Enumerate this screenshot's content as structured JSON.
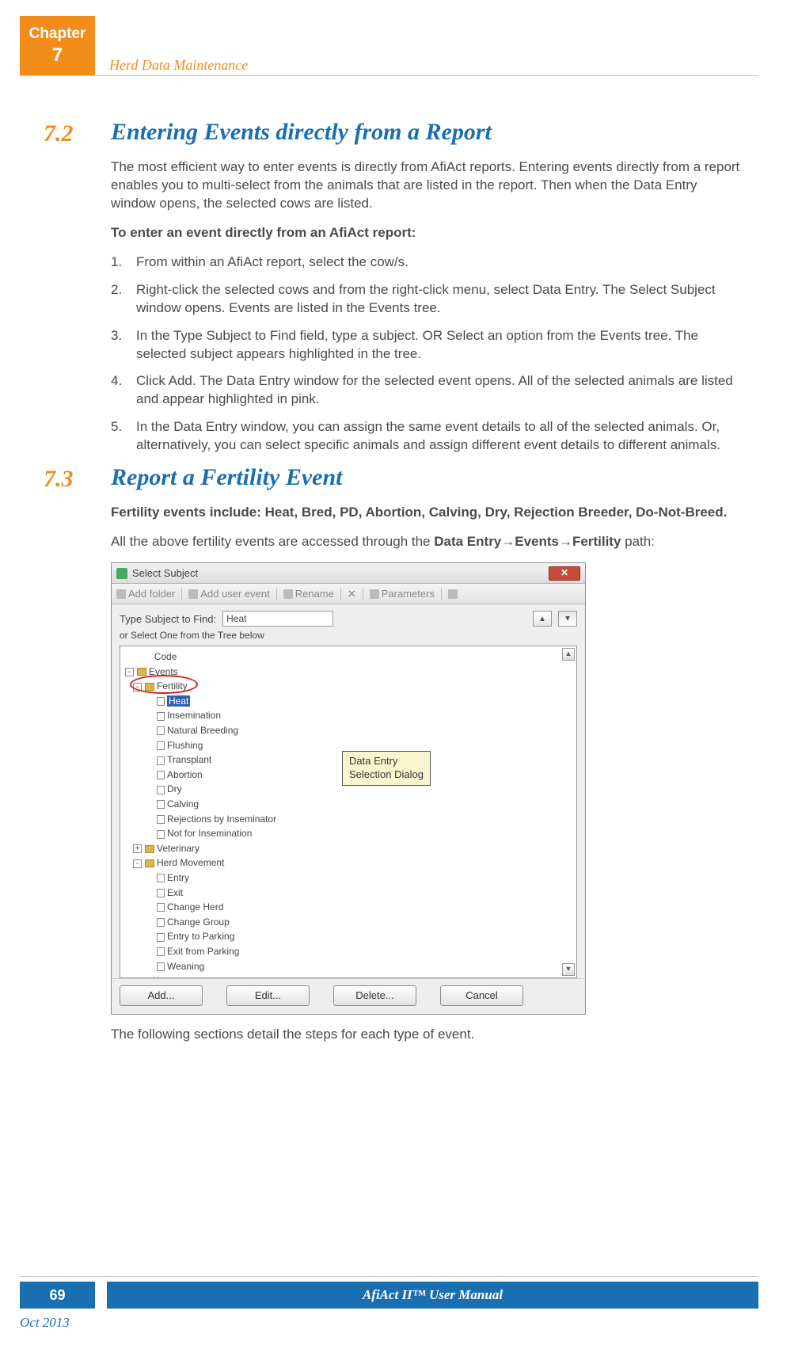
{
  "chapter": {
    "label": "Chapter",
    "number": "7"
  },
  "header": {
    "breadcrumb": "Herd Data Maintenance"
  },
  "section72": {
    "num": "7.2",
    "title": "Entering Events directly from a Report",
    "intro": "The most efficient way to enter events is directly from AfiAct reports. Entering events directly from a report enables you to multi-select from the animals that are listed in the report. Then when the Data Entry window opens, the selected cows are listed.",
    "procedure_heading": "To enter an event directly from an AfiAct report:",
    "steps": [
      "From within an AfiAct report, select the cow/s.",
      "Right-click the selected cows and from the right-click menu, select Data Entry. The Select Subject window opens. Events are listed in the Events tree.",
      "In the Type Subject to Find field, type a subject. OR Select an option from the Events tree. The selected subject appears highlighted in the tree.",
      "Click Add. The Data Entry window for the selected event opens. All of the selected animals are listed and appear highlighted in pink.",
      "In the Data Entry window, you can assign the same event details to all of the selected animals. Or, alternatively, you can select specific animals and assign different event details to different animals."
    ]
  },
  "section73": {
    "num": "7.3",
    "title": "Report a Fertility Event",
    "subhead": "Fertility events include: Heat, Bred, PD, Abortion, Calving, Dry, Rejection Breeder, Do-Not-Breed.",
    "body_pre": "All the above fertility events are accessed through the ",
    "body_path": "Data Entry→Events→Fertility",
    "body_post": " path:",
    "after_figure": "The following sections detail the steps for each type of event."
  },
  "dialog": {
    "title": "Select Subject",
    "toolbar": {
      "add_folder": "Add folder",
      "add_user_event": "Add user event",
      "rename": "Rename",
      "delete": "✕",
      "parameters": "Parameters"
    },
    "find_label": "Type Subject to Find:",
    "find_value": "Heat",
    "nav_prev": "▲",
    "nav_next": "▲",
    "subtext": "or Select One from the Tree below",
    "tree": {
      "code": "Code",
      "events": "Events",
      "fertility": "Fertility",
      "fertility_items": [
        "Heat",
        "Insemination",
        "Natural Breeding",
        "Flushing",
        "Transplant",
        "Abortion",
        "Dry",
        "Calving",
        "Rejections by Inseminator",
        "Not for Insemination"
      ],
      "veterinary": "Veterinary",
      "herd_movement": "Herd Movement",
      "herd_items": [
        "Entry",
        "Exit",
        "Change Herd",
        "Change Group",
        "Entry to Parking",
        "Exit from Parking",
        "Weaning"
      ],
      "user": "User"
    },
    "callout_l1": "Data Entry",
    "callout_l2": "Selection Dialog",
    "buttons": {
      "add": "Add...",
      "edit": "Edit...",
      "delete": "Delete...",
      "cancel": "Cancel"
    }
  },
  "footer": {
    "page": "69",
    "title": "AfiAct II™ User Manual",
    "date": "Oct 2013"
  }
}
